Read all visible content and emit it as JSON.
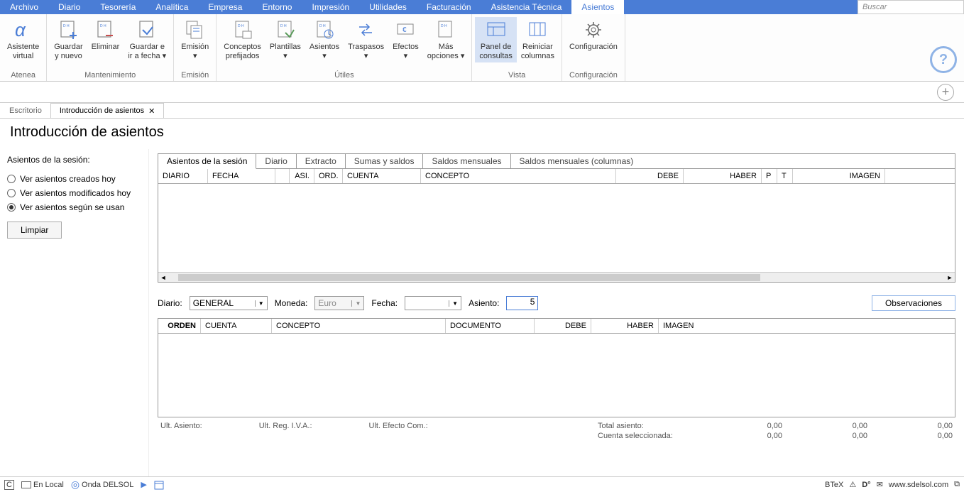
{
  "menubar": {
    "items": [
      "Archivo",
      "Diario",
      "Tesorería",
      "Analítica",
      "Empresa",
      "Entorno",
      "Impresión",
      "Utilidades",
      "Facturación",
      "Asistencia Técnica",
      "Asientos"
    ],
    "active": "Asientos",
    "search_placeholder": "Buscar"
  },
  "ribbon": {
    "groups": [
      {
        "label": "Atenea",
        "buttons": [
          {
            "label": "Asistente\nvirtual",
            "icon": "alpha"
          }
        ]
      },
      {
        "label": "Mantenimiento",
        "buttons": [
          {
            "label": "Guardar\ny nuevo",
            "icon": "save-new"
          },
          {
            "label": "Eliminar",
            "icon": "delete"
          },
          {
            "label": "Guardar e\nir a fecha  ▾",
            "icon": "save-goto"
          }
        ]
      },
      {
        "label": "Emisión",
        "buttons": [
          {
            "label": "Emisión\n▾",
            "icon": "emit"
          }
        ]
      },
      {
        "label": "Útiles",
        "buttons": [
          {
            "label": "Conceptos\nprefijados",
            "icon": "concepts"
          },
          {
            "label": "Plantillas\n▾",
            "icon": "templates"
          },
          {
            "label": "Asientos\n▾",
            "icon": "entries"
          },
          {
            "label": "Traspasos\n▾",
            "icon": "transfers"
          },
          {
            "label": "Efectos\n▾",
            "icon": "effects"
          },
          {
            "label": "Más\nopciones  ▾",
            "icon": "more"
          }
        ]
      },
      {
        "label": "Vista",
        "buttons": [
          {
            "label": "Panel de\nconsultas",
            "icon": "panel",
            "active": true
          },
          {
            "label": "Reiniciar\ncolumnas",
            "icon": "reset-cols"
          }
        ]
      },
      {
        "label": "Configuración",
        "buttons": [
          {
            "label": "Configuración",
            "icon": "gear"
          }
        ]
      }
    ]
  },
  "doctabs": {
    "items": [
      {
        "label": "Escritorio",
        "closable": false,
        "active": false
      },
      {
        "label": "Introducción de asientos",
        "closable": true,
        "active": true
      }
    ]
  },
  "page_title": "Introducción de asientos",
  "side": {
    "title": "Asientos de la sesión:",
    "options": [
      {
        "label": "Ver asientos creados hoy",
        "checked": false
      },
      {
        "label": "Ver asientos modificados hoy",
        "checked": false
      },
      {
        "label": "Ver asientos según se usan",
        "checked": true
      }
    ],
    "clear": "Limpiar"
  },
  "subtabs": {
    "items": [
      "Asientos de la sesión",
      "Diario",
      "Extracto",
      "Sumas y saldos",
      "Saldos mensuales",
      "Saldos mensuales (columnas)"
    ],
    "active": "Asientos de la sesión"
  },
  "grid1_headers": [
    "DIARIO",
    "FECHA",
    "",
    "ASI.",
    "ORD.",
    "CUENTA",
    "CONCEPTO",
    "DEBE",
    "HABER",
    "P",
    "T",
    "IMAGEN",
    ""
  ],
  "form": {
    "diario_label": "Diario:",
    "diario_value": "GENERAL",
    "moneda_label": "Moneda:",
    "moneda_value": "Euro",
    "fecha_label": "Fecha:",
    "fecha_value": "",
    "asiento_label": "Asiento:",
    "asiento_value": "5",
    "observaciones": "Observaciones"
  },
  "grid2_headers": [
    "ORDEN",
    "CUENTA",
    "CONCEPTO",
    "DOCUMENTO",
    "DEBE",
    "HABER",
    "IMAGEN"
  ],
  "footer": {
    "ult_asiento": "Ult. Asiento:",
    "ult_reg_iva": "Ult. Reg. I.V.A.:",
    "ult_efecto": "Ult. Efecto Com.:",
    "total_asiento_label": "Total asiento:",
    "cuenta_sel_label": "Cuenta seleccionada:",
    "v1": "0,00",
    "v2": "0,00",
    "v3": "0,00",
    "w1": "0,00",
    "w2": "0,00",
    "w3": "0,00"
  },
  "statusbar": {
    "local": "En Local",
    "onda": "Onda DELSOL",
    "btex": "BTeX",
    "url": "www.sdelsol.com"
  }
}
